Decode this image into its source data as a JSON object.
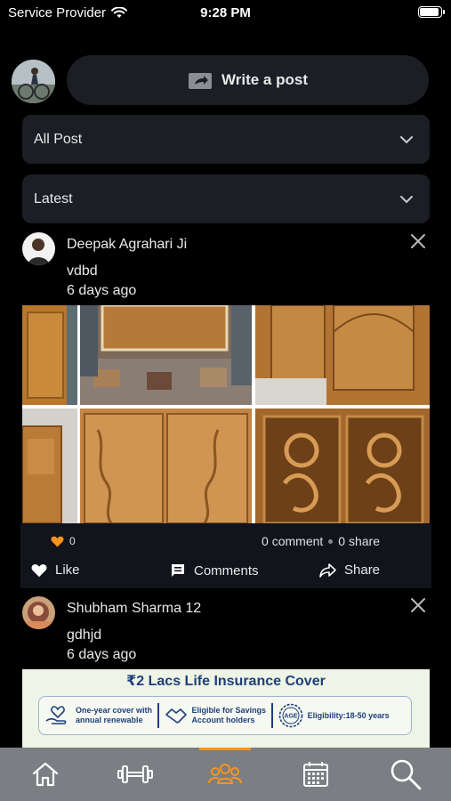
{
  "status_bar": {
    "carrier": "Service Provider",
    "time": "9:28 PM",
    "battery_level": 1.0
  },
  "composer": {
    "write_post_label": "Write a post"
  },
  "filters": {
    "category": "All Post",
    "sort": "Latest"
  },
  "posts": [
    {
      "author": "Deepak Agrahari Ji",
      "text": "vdbd",
      "time": "6 days ago",
      "reactions": "0",
      "comments_count": "0 comment",
      "shares_count": "0 share",
      "like_label": "Like",
      "comments_label": "Comments",
      "share_label": "Share"
    },
    {
      "author": "Shubham Sharma 12",
      "text": "gdhjd",
      "time": "6 days ago"
    }
  ],
  "ad": {
    "title": "₹2 Lacs Life Insurance Cover",
    "item1_line1": "One-year cover with",
    "item1_line2": "annual renewable",
    "item2_line1": "Eligible for Savings",
    "item2_line2": "Account holders",
    "item3_badge": "AGE",
    "item3_text": "Eligibility:18-50 years"
  },
  "tabs": [
    {
      "icon": "home-icon"
    },
    {
      "icon": "dumbbell-icon"
    },
    {
      "icon": "community-icon",
      "active": true
    },
    {
      "icon": "calendar-icon"
    },
    {
      "icon": "search-icon"
    }
  ],
  "colors": {
    "accent": "#f7941e",
    "card": "#1b1e24",
    "tab_bar": "#7b7e82",
    "heart": "#f7941e"
  }
}
